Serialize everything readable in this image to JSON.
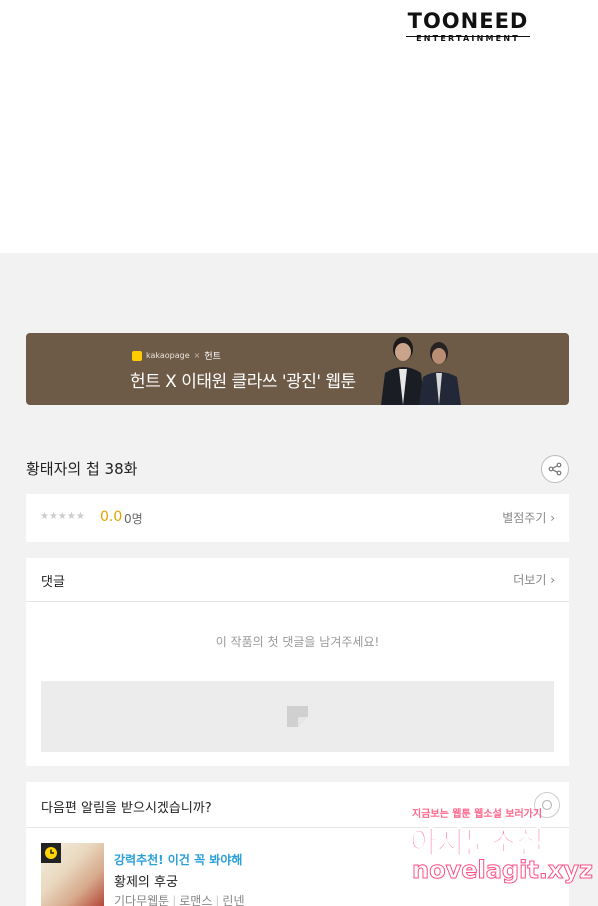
{
  "logo": {
    "main": "TOONEED",
    "sub": "ENTERTAINMENT"
  },
  "banner": {
    "brand": "kakaopage",
    "brand_x": "×",
    "brand_partner": "헌트",
    "title": "헌트 X 이태원 클라쓰 '광진' 웹툰"
  },
  "episode": {
    "title": "황태자의 첩 38화"
  },
  "rating": {
    "stars": "★★★★★",
    "value": "0.0",
    "count": "0명",
    "rate_link": "별점주기 ›"
  },
  "comments": {
    "title": "댓글",
    "more": "더보기 ›",
    "empty_message": "이 작품의 첫 댓글을 남겨주세요!"
  },
  "notify": {
    "title": "다음편 알림을 받으시겠습니까?",
    "recommend": {
      "tag": "강력추천! 이건 꼭 봐야해",
      "title": "황제의 후궁",
      "meta": [
        "기다무웹툰",
        "로맨스",
        "린넨"
      ]
    }
  },
  "watermark": {
    "line1": "지금보는 웹툰 웹소설 보러가기",
    "line2": "아지툰소설",
    "line3": "novelagit.xyz"
  },
  "colors": {
    "rating_accent": "#e2a100",
    "recommend_tag": "#2a9fd8",
    "banner_bg": "#6d5a47",
    "watermark_pink": "#ff4f86"
  }
}
